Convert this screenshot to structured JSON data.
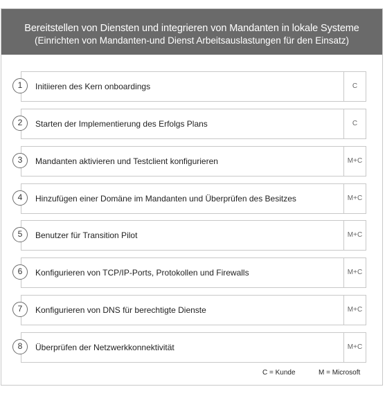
{
  "header": {
    "title": "Bereitstellen von Diensten und integrieren von Mandanten in lokale Systeme",
    "subtitle": "(Einrichten von Mandanten-und Dienst Arbeitsauslastungen für den Einsatz)"
  },
  "steps": [
    {
      "number": "1",
      "label": "Initiieren des Kern onboardings",
      "tag": "C"
    },
    {
      "number": "2",
      "label": "Starten der Implementierung des Erfolgs Plans",
      "tag": "C"
    },
    {
      "number": "3",
      "label": "Mandanten aktivieren und Testclient konfigurieren",
      "tag": "M+C"
    },
    {
      "number": "4",
      "label": "Hinzufügen einer Domäne im Mandanten und Überprüfen des Besitzes",
      "tag": "M+C"
    },
    {
      "number": "5",
      "label": "Benutzer für Transition Pilot",
      "tag": "M+C"
    },
    {
      "number": "6",
      "label": "Konfigurieren von TCP/IP-Ports, Protokollen und Firewalls",
      "tag": "M+C"
    },
    {
      "number": "7",
      "label": "Konfigurieren von DNS für berechtigte Dienste",
      "tag": "M+C"
    },
    {
      "number": "8",
      "label": "Überprüfen der Netzwerkkonnektivität",
      "tag": "M+C"
    }
  ],
  "legend": {
    "customer": "C = Kunde",
    "microsoft": "M = Microsoft"
  },
  "colors": {
    "header_background": "#6a6a6a",
    "border": "#c8c8c8"
  }
}
